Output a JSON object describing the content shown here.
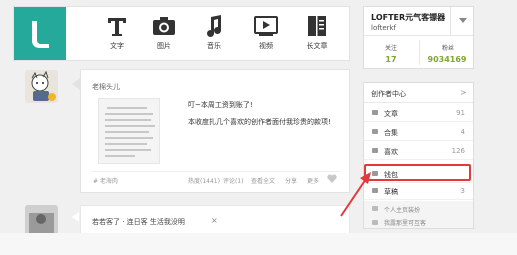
{
  "publish_bar": {
    "items": [
      {
        "label": "文字",
        "icon": "text-icon"
      },
      {
        "label": "图片",
        "icon": "camera-icon"
      },
      {
        "label": "音乐",
        "icon": "music-icon"
      },
      {
        "label": "视频",
        "icon": "video-icon"
      },
      {
        "label": "长文章",
        "icon": "long-article-icon"
      }
    ]
  },
  "user_card": {
    "name": "LOFTER元气客镖器",
    "handle": "lofterkf",
    "following_label": "关注",
    "following_count": "17",
    "followers_label": "粉丝",
    "followers_count": "9034169"
  },
  "post": {
    "author": "老棉头儿",
    "text_line1": "叮~本周工资到账了!",
    "text_line2": "本收度扎几个喜欢的创作者面付我珍贵的款项!",
    "tag": "# 老海肉",
    "actions": {
      "hot": "热度(1441)",
      "comments": "评论(1)",
      "share": "查看全文",
      "reblog": "分享",
      "more": "更多"
    }
  },
  "post2": {
    "text": "若若客了 · 连日客 生活我没明",
    "close": "×"
  },
  "creator_center": {
    "title": "创作者中心",
    "arrow": ">",
    "rows": [
      {
        "label": "文章",
        "count": "91"
      },
      {
        "label": "合集",
        "count": "4"
      },
      {
        "label": "喜欢",
        "count": "126"
      },
      {
        "label": "钱包",
        "count": ""
      },
      {
        "label": "草稿",
        "count": "3"
      }
    ],
    "extras": [
      {
        "label": "个人主页装扮"
      },
      {
        "label": "我露那里可互客"
      }
    ]
  },
  "colors": {
    "brand": "#24a99b",
    "stat": "#7fa62d",
    "highlight": "#e5383b"
  }
}
